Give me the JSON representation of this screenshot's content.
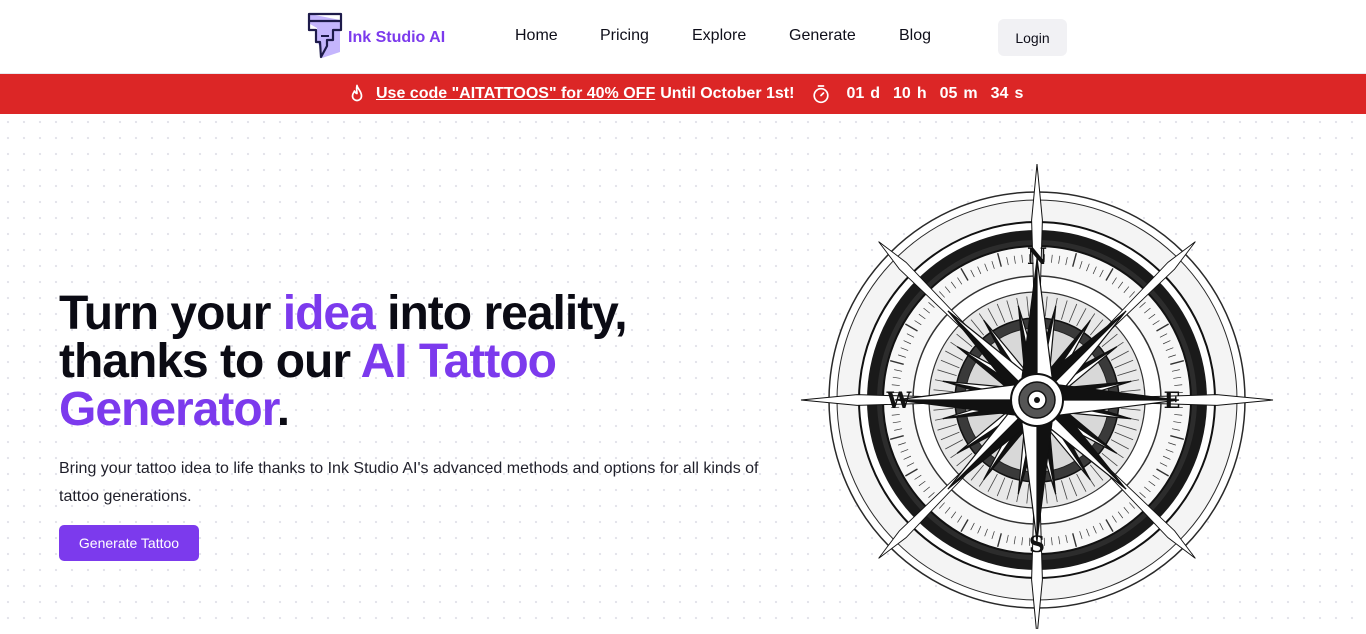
{
  "brand": {
    "name": "Ink Studio AI",
    "logo_icon": "tattoo-machine-icon",
    "accent_color": "#7c3aed"
  },
  "nav": {
    "items": [
      {
        "label": "Home"
      },
      {
        "label": "Pricing"
      },
      {
        "label": "Explore"
      },
      {
        "label": "Generate"
      },
      {
        "label": "Blog"
      }
    ],
    "login_label": "Login"
  },
  "promo": {
    "background_color": "#dc2626",
    "fire_icon": "flame-icon",
    "code_text": "Use code \"AITATTOOS\" for 40% OFF",
    "until_text": "Until October 1st!",
    "timer_icon": "stopwatch-icon",
    "countdown": {
      "days": "01",
      "days_unit": "d",
      "hours": "10",
      "hours_unit": "h",
      "minutes": "05",
      "minutes_unit": "m",
      "seconds": "34",
      "seconds_unit": "s"
    }
  },
  "hero": {
    "headline": {
      "part1": "Turn your ",
      "accent1": "idea",
      "part2": " into reality,",
      "part3": "thanks to our ",
      "accent2": "AI Tattoo",
      "accent3": "Generator",
      "part4": "."
    },
    "subtext": "Bring your tattoo idea to life thanks to Ink Studio AI's advanced methods and options for all kinds of tattoo generations.",
    "cta_label": "Generate Tattoo",
    "image": {
      "subject": "compass-rose-tattoo",
      "letters": {
        "north": "N",
        "south": "S",
        "east": "E",
        "west": "W"
      }
    }
  }
}
